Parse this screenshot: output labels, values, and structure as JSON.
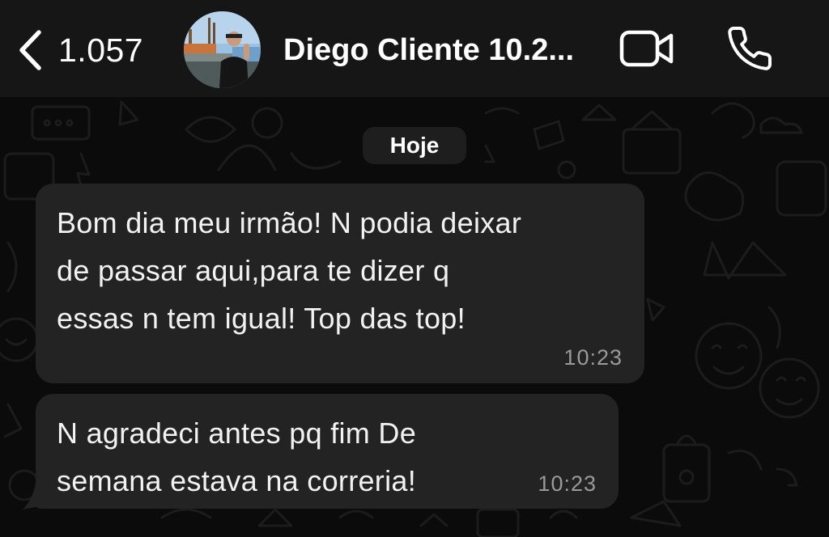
{
  "header": {
    "back_count": "1.057",
    "contact_name": "Diego Cliente 10.2..."
  },
  "chat": {
    "date_label": "Hoje",
    "messages": [
      {
        "lines": [
          "Bom dia meu irmão! N podia deixar",
          "de passar aqui,para te dizer q",
          "essas n tem igual! Top das top!"
        ],
        "time": "10:23",
        "direction": "incoming"
      },
      {
        "lines": [
          "N agradeci antes pq fim De",
          "semana estava na correria!"
        ],
        "time": "10:23",
        "direction": "incoming"
      }
    ]
  },
  "colors": {
    "header_bg": "#161616",
    "chat_bg": "#0b0b0b",
    "bubble_bg": "#232323",
    "time_text": "#9a9a9a"
  },
  "icons": [
    "chevron-left-icon",
    "video-camera-icon",
    "phone-icon"
  ]
}
